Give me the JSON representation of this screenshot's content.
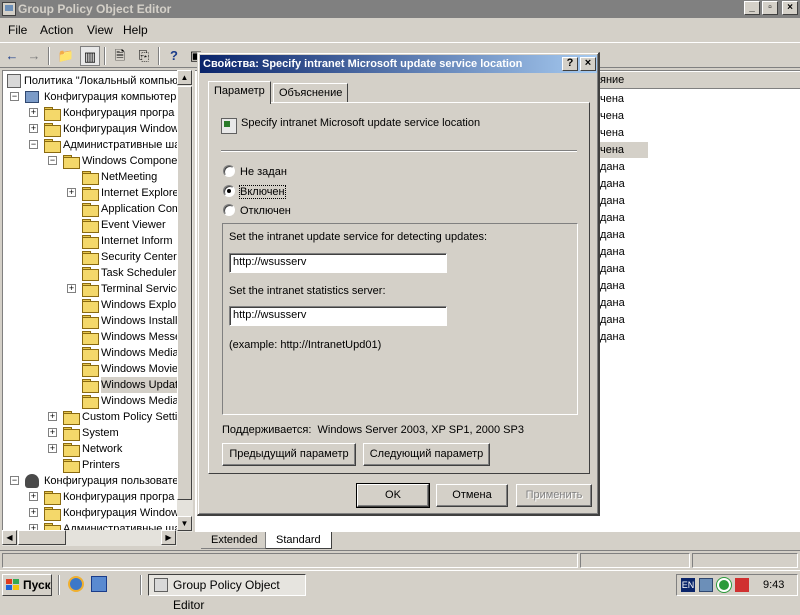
{
  "window": {
    "title": "Group Policy Object Editor",
    "controls": [
      "_",
      "▫",
      "×"
    ]
  },
  "menu": {
    "file": "File",
    "action": "Action",
    "view": "View",
    "help": "Help"
  },
  "tree": {
    "root": "Политика \"Локальный компьют",
    "items": [
      {
        "label": "Конфигурация компьютер",
        "level": 1,
        "exp": "-",
        "icon": "computer"
      },
      {
        "label": "Конфигурация програ",
        "level": 2,
        "exp": "+",
        "icon": "folder"
      },
      {
        "label": "Конфигурация Window",
        "level": 2,
        "exp": "+",
        "icon": "folder"
      },
      {
        "label": "Административные ша",
        "level": 2,
        "exp": "-",
        "icon": "folder"
      },
      {
        "label": "Windows Componer",
        "level": 3,
        "exp": "-",
        "icon": "folder"
      },
      {
        "label": "NetMeeting",
        "level": 4,
        "exp": "",
        "icon": "folder"
      },
      {
        "label": "Internet Explore",
        "level": 4,
        "exp": "+",
        "icon": "folder"
      },
      {
        "label": "Application Com",
        "level": 4,
        "exp": "",
        "icon": "folder"
      },
      {
        "label": "Event Viewer",
        "level": 4,
        "exp": "",
        "icon": "folder"
      },
      {
        "label": "Internet Inform",
        "level": 4,
        "exp": "",
        "icon": "folder"
      },
      {
        "label": "Security Center",
        "level": 4,
        "exp": "",
        "icon": "folder"
      },
      {
        "label": "Task Scheduler",
        "level": 4,
        "exp": "",
        "icon": "folder"
      },
      {
        "label": "Terminal Service",
        "level": 4,
        "exp": "+",
        "icon": "folder"
      },
      {
        "label": "Windows Explor",
        "level": 4,
        "exp": "",
        "icon": "folder"
      },
      {
        "label": "Windows Install",
        "level": 4,
        "exp": "",
        "icon": "folder"
      },
      {
        "label": "Windows Messe",
        "level": 4,
        "exp": "",
        "icon": "folder"
      },
      {
        "label": "Windows Media",
        "level": 4,
        "exp": "",
        "icon": "folder"
      },
      {
        "label": "Windows Movie",
        "level": 4,
        "exp": "",
        "icon": "folder"
      },
      {
        "label": "Windows Updat",
        "level": 4,
        "exp": "",
        "icon": "folder-open",
        "selected": true
      },
      {
        "label": "Windows Media",
        "level": 4,
        "exp": "",
        "icon": "folder"
      },
      {
        "label": "Custom Policy Settir",
        "level": 3,
        "exp": "+",
        "icon": "folder"
      },
      {
        "label": "System",
        "level": 3,
        "exp": "+",
        "icon": "folder"
      },
      {
        "label": "Network",
        "level": 3,
        "exp": "+",
        "icon": "folder"
      },
      {
        "label": "Printers",
        "level": 3,
        "exp": "",
        "icon": "folder"
      },
      {
        "label": "Конфигурация пользовате",
        "level": 1,
        "exp": "-",
        "icon": "user"
      },
      {
        "label": "Конфигурация програ",
        "level": 2,
        "exp": "+",
        "icon": "folder"
      },
      {
        "label": "Конфигурация Window",
        "level": 2,
        "exp": "+",
        "icon": "folder"
      },
      {
        "label": "Административные ша",
        "level": 2,
        "exp": "+",
        "icon": "folder"
      }
    ]
  },
  "list": {
    "column_header": "яние",
    "states": [
      "чена",
      "чена",
      "чена",
      "чена",
      "дана",
      "дана",
      "дана",
      "дана",
      "дана",
      "дана",
      "дана",
      "дана",
      "дана",
      "дана",
      "дана"
    ],
    "highlighted_index": 3
  },
  "bottom_tabs": {
    "extended": "Extended",
    "standard": "Standard"
  },
  "dialog": {
    "title": "Свойства: Specify intranet Microsoft update service location",
    "help_btn": "?",
    "close_btn": "×",
    "tabs": {
      "parameter": "Параметр",
      "explanation": "Объяснение"
    },
    "policy_name": "Specify intranet Microsoft update service location",
    "radios": [
      {
        "label": "Не задан",
        "checked": false
      },
      {
        "label": "Включен",
        "checked": true
      },
      {
        "label": "Отключен",
        "checked": false
      }
    ],
    "field1_label": "Set the intranet update service for detecting updates:",
    "field1_value": "http://wsusserv",
    "field2_label": "Set the intranet statistics server:",
    "field2_value": "http://wsusserv",
    "example": "(example: http://IntranetUpd01)",
    "supported": "Поддерживается:  Windows Server 2003, XP SP1, 2000 SP3",
    "prev_btn": "Предыдущий параметр",
    "next_btn": "Следующий параметр",
    "ok_btn": "OK",
    "cancel_btn": "Отмена",
    "apply_btn": "Применить"
  },
  "taskbar": {
    "start": "Пуск",
    "task": "Group Policy Object Editor",
    "lang": "EN",
    "clock": "9:43"
  }
}
